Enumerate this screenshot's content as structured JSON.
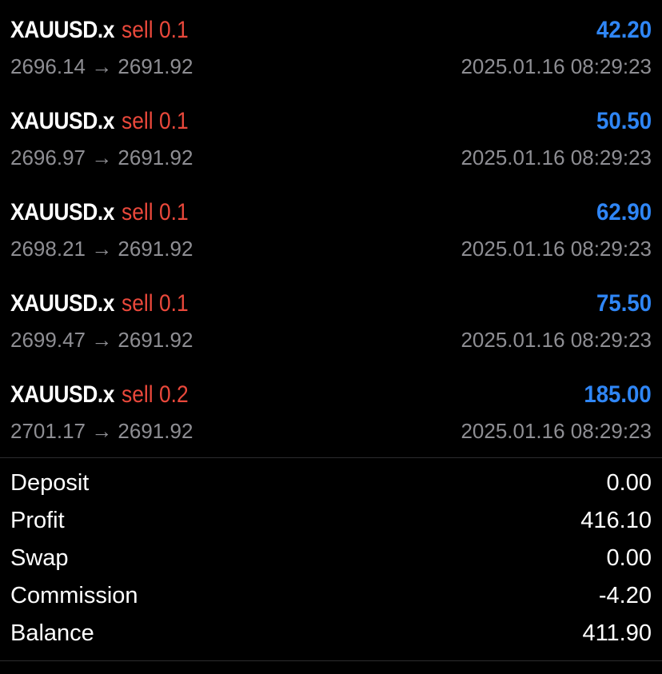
{
  "colors": {
    "background": "#000000",
    "sell": "#e9483b",
    "profit": "#2f86f6",
    "secondary_text": "#8e8e93",
    "primary_text": "#ffffff"
  },
  "deals": [
    {
      "symbol": "XAUUSD.x",
      "side_volume": "sell 0.1",
      "profit": "42.20",
      "prices": "2696.14 → 2691.92",
      "time": "2025.01.16 08:29:23"
    },
    {
      "symbol": "XAUUSD.x",
      "side_volume": "sell 0.1",
      "profit": "50.50",
      "prices": "2696.97 → 2691.92",
      "time": "2025.01.16 08:29:23"
    },
    {
      "symbol": "XAUUSD.x",
      "side_volume": "sell 0.1",
      "profit": "62.90",
      "prices": "2698.21 → 2691.92",
      "time": "2025.01.16 08:29:23"
    },
    {
      "symbol": "XAUUSD.x",
      "side_volume": "sell 0.1",
      "profit": "75.50",
      "prices": "2699.47 → 2691.92",
      "time": "2025.01.16 08:29:23"
    },
    {
      "symbol": "XAUUSD.x",
      "side_volume": "sell 0.2",
      "profit": "185.00",
      "prices": "2701.17 → 2691.92",
      "time": "2025.01.16 08:29:23"
    }
  ],
  "summary": [
    {
      "label": "Deposit",
      "value": "0.00"
    },
    {
      "label": "Profit",
      "value": "416.10"
    },
    {
      "label": "Swap",
      "value": "0.00"
    },
    {
      "label": "Commission",
      "value": "-4.20"
    },
    {
      "label": "Balance",
      "value": "411.90"
    }
  ]
}
